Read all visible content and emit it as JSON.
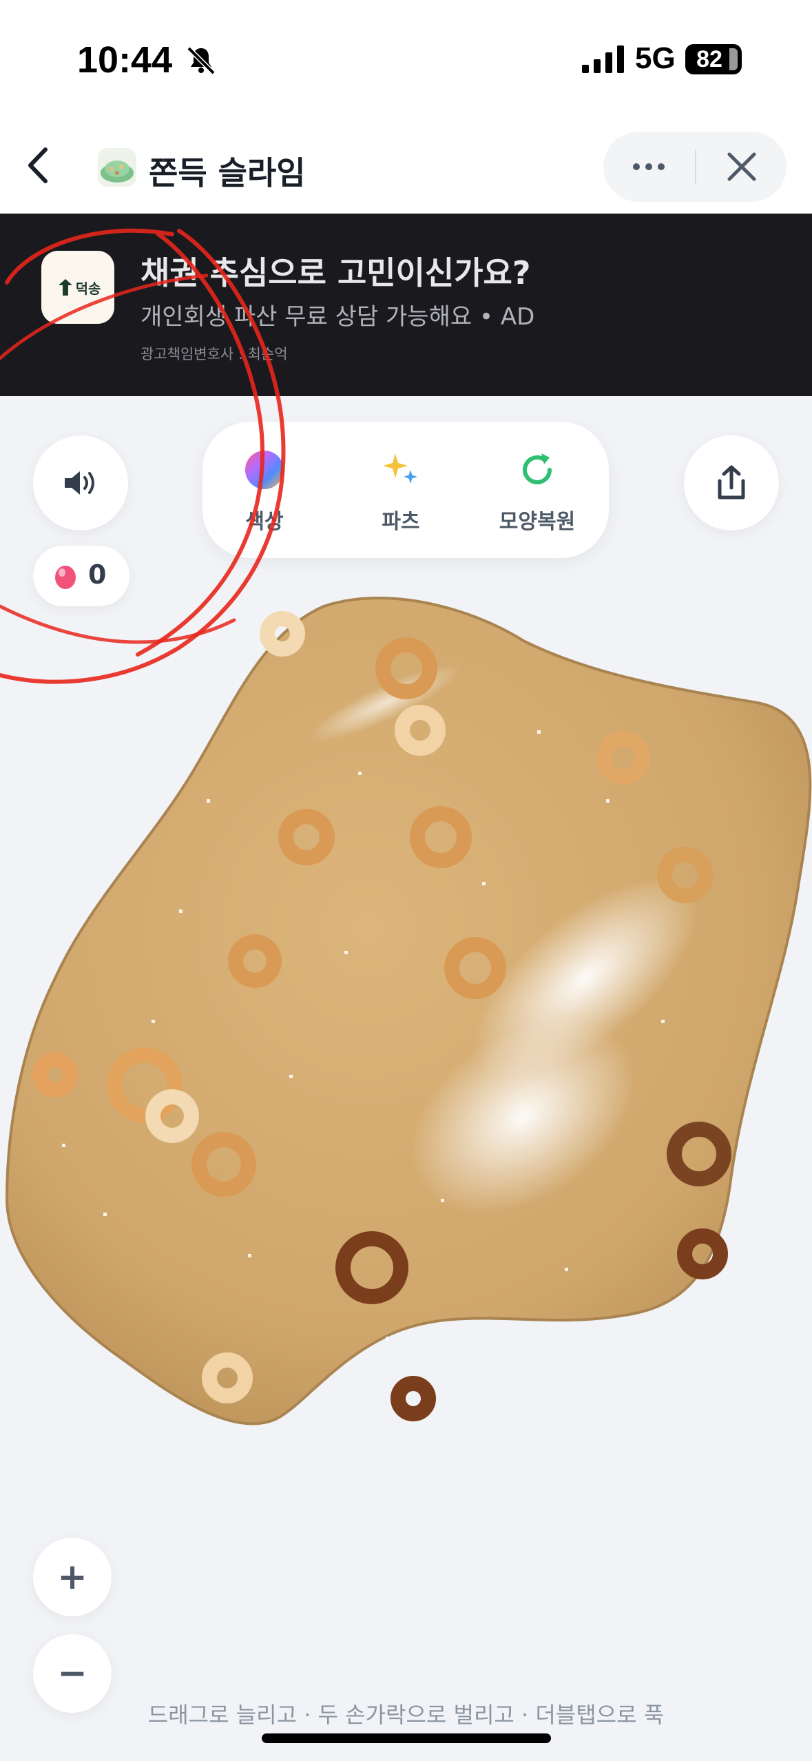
{
  "status_bar": {
    "time": "10:44",
    "network": "5G",
    "battery": "82"
  },
  "nav": {
    "title": "쫀득 슬라임",
    "app_icon": "slime-icon",
    "back_icon": "chevron-left-icon",
    "more_icon": "more-horizontal-icon",
    "close_icon": "close-icon"
  },
  "ad": {
    "logo_text": "덕송",
    "title": "채권 추심으로 고민이신가요?",
    "subtitle": "개인회생 파산 무료 상담 가능해요 • AD",
    "disclaimer": "광고책임변호사 : 최순억"
  },
  "controls": {
    "sound_icon": "speaker-icon",
    "share_icon": "share-icon",
    "gem_count": "0",
    "gem_icon": "pink-gem-icon"
  },
  "tools": [
    {
      "label": "색상",
      "icon": "color-wheel-icon"
    },
    {
      "label": "파츠",
      "icon": "sparkles-icon"
    },
    {
      "label": "모양복원",
      "icon": "refresh-icon"
    }
  ],
  "zoom": {
    "in": "+",
    "out": "−"
  },
  "hint": "드래그로 늘리고 · 두 손가락으로 벌리고 · 더블탭으로 푹",
  "colors": {
    "slime": "#d6b077",
    "ad_background": "#1a1a1e",
    "reset_green": "#2fbf71",
    "annotation_red": "#e8261c"
  }
}
